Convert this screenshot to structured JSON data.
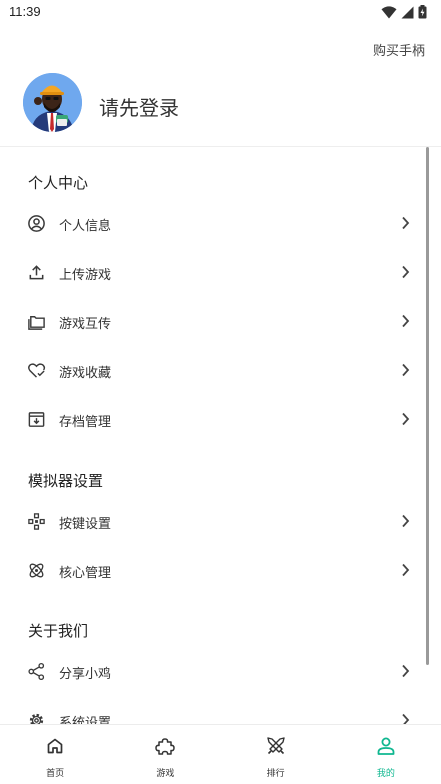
{
  "status": {
    "time": "11:39"
  },
  "header": {
    "buy_handle": "购买手柄",
    "login_prompt": "请先登录"
  },
  "colors": {
    "accent": "#0fb790",
    "text": "#222222",
    "icon": "#3a3a3a"
  },
  "sections": [
    {
      "title": "个人中心",
      "items": [
        {
          "label": "个人信息",
          "icon": "user-circle-icon"
        },
        {
          "label": "上传游戏",
          "icon": "upload-icon"
        },
        {
          "label": "游戏互传",
          "icon": "folder-icon"
        },
        {
          "label": "游戏收藏",
          "icon": "heart-check-icon"
        },
        {
          "label": "存档管理",
          "icon": "archive-icon"
        }
      ]
    },
    {
      "title": "模拟器设置",
      "items": [
        {
          "label": "按键设置",
          "icon": "gamepad-icon"
        },
        {
          "label": "核心管理",
          "icon": "atom-icon"
        }
      ]
    },
    {
      "title": "关于我们",
      "items": [
        {
          "label": "分享小鸡",
          "icon": "share-icon"
        },
        {
          "label": "系统设置",
          "icon": "gear-icon"
        }
      ]
    }
  ],
  "bottom_nav": [
    {
      "label": "首页",
      "icon": "home-icon"
    },
    {
      "label": "游戏",
      "icon": "puzzle-icon"
    },
    {
      "label": "排行",
      "icon": "swords-icon"
    },
    {
      "label": "我的",
      "icon": "person-icon",
      "active": true
    }
  ]
}
